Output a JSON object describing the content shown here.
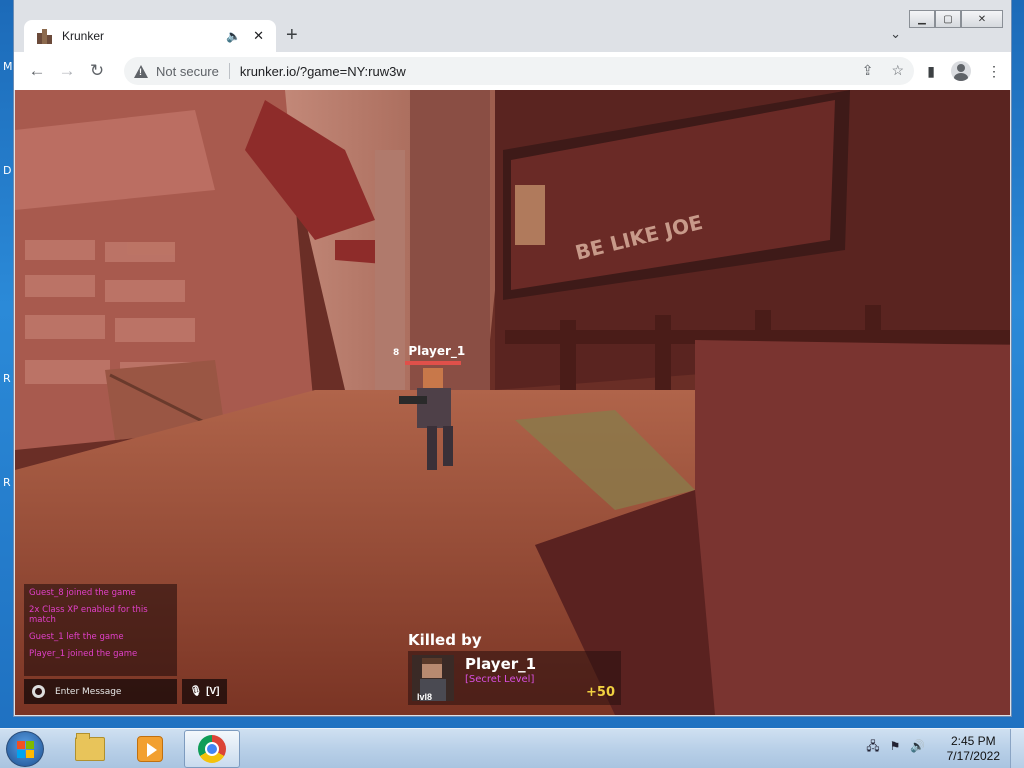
{
  "desktop": {
    "edge_letters": [
      "M",
      "D",
      "R",
      "R"
    ]
  },
  "browser": {
    "tab": {
      "title": "Krunker"
    },
    "new_tab_label": "+",
    "omnibox": {
      "security_label": "Not secure",
      "url": "krunker.io/?game=NY:ruw3w"
    }
  },
  "game": {
    "scene_sign_text": "BE LIKE JOE",
    "nametag": {
      "level": "8",
      "name": "Player_1"
    },
    "chat": {
      "messages": [
        "Guest_8 joined the game",
        "2x Class XP enabled for this match",
        "Guest_1 left the game",
        "Player_1 joined the game"
      ],
      "input_placeholder": "Enter Message",
      "voice_key_label": "[V]"
    },
    "death": {
      "killed_by_label": "Killed by",
      "killer_name": "Player_1",
      "killer_rank": "[Secret Level]",
      "killer_level": "lvl8",
      "score": "+50"
    }
  },
  "taskbar": {
    "clock": {
      "time": "2:45 PM",
      "date": "7/17/2022"
    }
  },
  "colors": {
    "chat_text": "#e040c8",
    "rank_text": "#d850e0",
    "score_text": "#f0d040",
    "nametag_bar": "#e0504a"
  }
}
